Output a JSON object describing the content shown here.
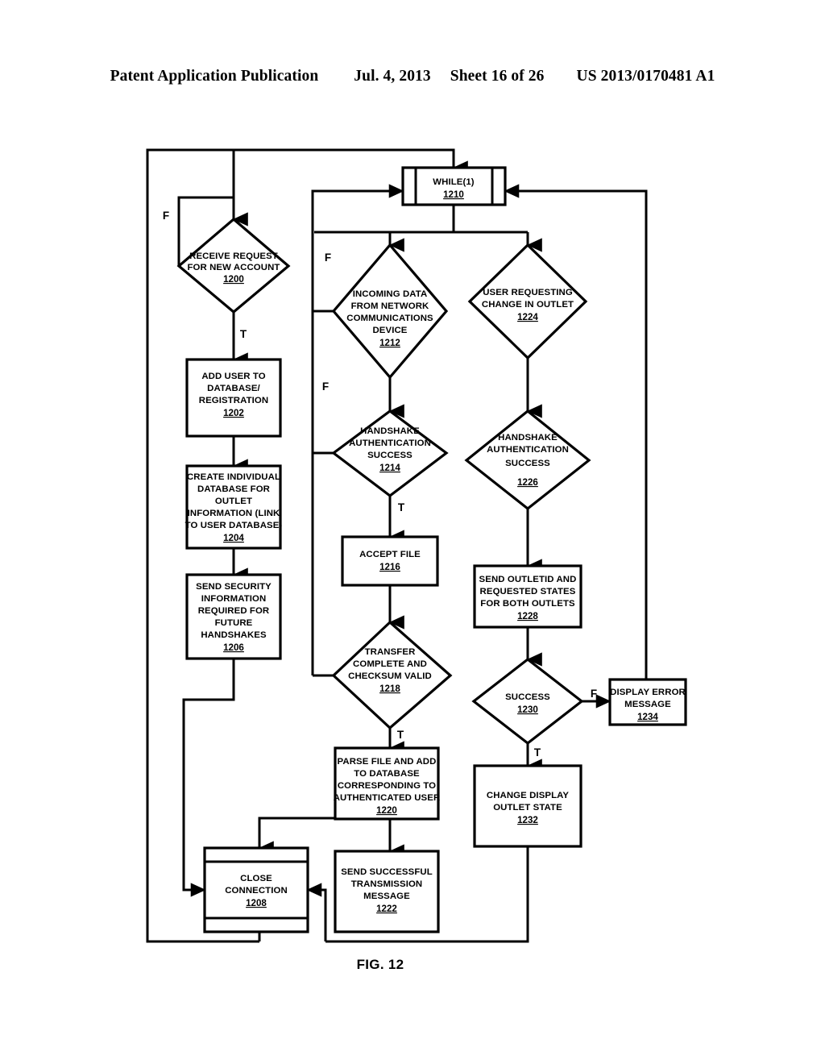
{
  "header": {
    "publication": "Patent Application Publication",
    "date": "Jul. 4, 2013",
    "sheet": "Sheet 16 of 26",
    "patent_number": "US 2013/0170481 A1"
  },
  "figure": {
    "caption": "FIG. 12"
  },
  "nodes": {
    "n1200": {
      "lines": [
        "RECEIVE REQUEST",
        "FOR NEW ACCOUNT"
      ],
      "ref": "1200",
      "shape": "decision"
    },
    "n1202": {
      "lines": [
        "ADD USER TO",
        "DATABASE/",
        "REGISTRATION"
      ],
      "ref": "1202",
      "shape": "process"
    },
    "n1204": {
      "lines": [
        "CREATE INDIVIDUAL",
        "DATABASE FOR",
        "OUTLET",
        "INFORMATION (LINK",
        "TO USER DATABASE)"
      ],
      "ref": "1204",
      "shape": "process"
    },
    "n1206": {
      "lines": [
        "SEND SECURITY",
        "INFORMATION",
        "REQUIRED FOR",
        "FUTURE",
        "HANDSHAKES"
      ],
      "ref": "1206",
      "shape": "process"
    },
    "n1208": {
      "lines": [
        "CLOSE",
        "CONNECTION"
      ],
      "ref": "1208",
      "shape": "predefined-horizontal"
    },
    "n1210": {
      "lines": [
        "WHILE(1)"
      ],
      "ref": "1210",
      "shape": "predefined-vertical"
    },
    "n1212": {
      "lines": [
        "INCOMING DATA",
        "FROM NETWORK",
        "COMMUNICATIONS",
        "DEVICE"
      ],
      "ref": "1212",
      "shape": "decision"
    },
    "n1214": {
      "lines": [
        "HANDSHAKE",
        "AUTHENTICATION",
        "SUCCESS"
      ],
      "ref": "1214",
      "shape": "decision"
    },
    "n1216": {
      "lines": [
        "ACCEPT FILE"
      ],
      "ref": "1216",
      "shape": "process"
    },
    "n1218": {
      "lines": [
        "TRANSFER",
        "COMPLETE AND",
        "CHECKSUM VALID"
      ],
      "ref": "1218",
      "shape": "decision"
    },
    "n1220": {
      "lines": [
        "PARSE FILE AND ADD",
        "TO DATABASE",
        "CORRESPONDING TO",
        "AUTHENTICATED USER"
      ],
      "ref": "1220",
      "shape": "process"
    },
    "n1222": {
      "lines": [
        "SEND SUCCESSFUL",
        "TRANSMISSION",
        "MESSAGE"
      ],
      "ref": "1222",
      "shape": "process"
    },
    "n1224": {
      "lines": [
        "USER REQUESTING",
        "CHANGE IN OUTLET"
      ],
      "ref": "1224",
      "shape": "decision"
    },
    "n1226": {
      "lines": [
        "HANDSHAKE",
        "AUTHENTICATION",
        "SUCCESS"
      ],
      "ref": "1226",
      "shape": "decision"
    },
    "n1228": {
      "lines": [
        "SEND OUTLETID AND",
        "REQUESTED STATES",
        "FOR BOTH OUTLETS"
      ],
      "ref": "1228",
      "shape": "process"
    },
    "n1230": {
      "lines": [
        "SUCCESS"
      ],
      "ref": "1230",
      "shape": "decision"
    },
    "n1232": {
      "lines": [
        "CHANGE DISPLAY",
        "OUTLET STATE"
      ],
      "ref": "1232",
      "shape": "process"
    },
    "n1234": {
      "lines": [
        "DISPLAY ERROR",
        "MESSAGE"
      ],
      "ref": "1234",
      "shape": "process"
    }
  },
  "branch_labels": {
    "f_1200": "F",
    "t_1200": "T",
    "f_1212": "F",
    "f_1214": "F",
    "t_1214": "T",
    "t_1218": "T",
    "f_1230": "F",
    "t_1230": "T"
  },
  "colors": {
    "stroke": "#000000",
    "fill": "#ffffff",
    "text": "#000000"
  }
}
